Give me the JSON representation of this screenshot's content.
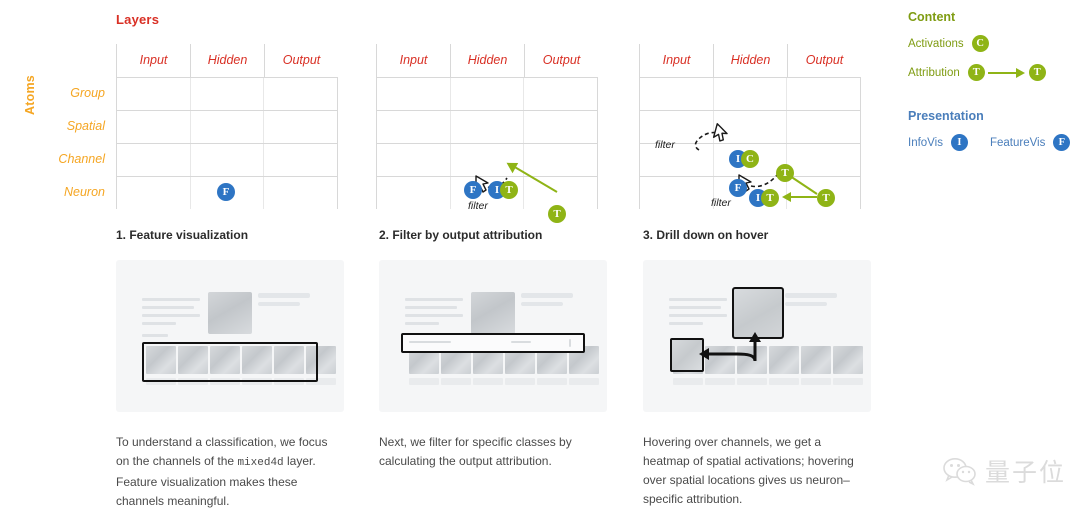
{
  "matrix": {
    "title": "Layers",
    "axis_label_rows": "Atoms",
    "columns": [
      "Input",
      "Hidden",
      "Output"
    ],
    "rows": [
      "Group",
      "Spatial",
      "Channel",
      "Neuron"
    ],
    "filter_label": "filter",
    "badges": {
      "featurevis": "F",
      "infovis": "I",
      "attribution": "T",
      "activations": "C"
    }
  },
  "legend": {
    "content_heading": "Content",
    "activations_label": "Activations",
    "activations_badge": "C",
    "attribution_label": "Attribution",
    "attribution_badge_from": "T",
    "attribution_badge_to": "T",
    "presentation_heading": "Presentation",
    "infovis_label": "InfoVis",
    "infovis_badge": "I",
    "featurevis_label": "FeatureVis",
    "featurevis_badge": "F",
    "colors": {
      "content_green": "#7f9c12",
      "badge_green": "#8fb416",
      "presentation_blue": "#4a7ebb",
      "badge_blue": "#2e75c4",
      "layers_red": "#d93025",
      "atoms_orange": "#f5a623"
    }
  },
  "panels": [
    {
      "title": "1. Feature visualization",
      "caption_before": "To understand a classification, we focus on the channels of the ",
      "caption_mono": "mixed4d",
      "caption_after": " layer. Feature visualization makes these channels meaningful."
    },
    {
      "title": "2. Filter by output attribution",
      "caption_before": "Next, we filter for specific classes by calculating the output attribution.",
      "caption_mono": "",
      "caption_after": ""
    },
    {
      "title": "3. Drill down on hover",
      "caption_before": "Hovering over channels, we get a heatmap of spatial activations; hovering over spatial locations gives us neuron–specific attribution.",
      "caption_mono": "",
      "caption_after": ""
    }
  ],
  "watermark": {
    "text": "量子位"
  }
}
